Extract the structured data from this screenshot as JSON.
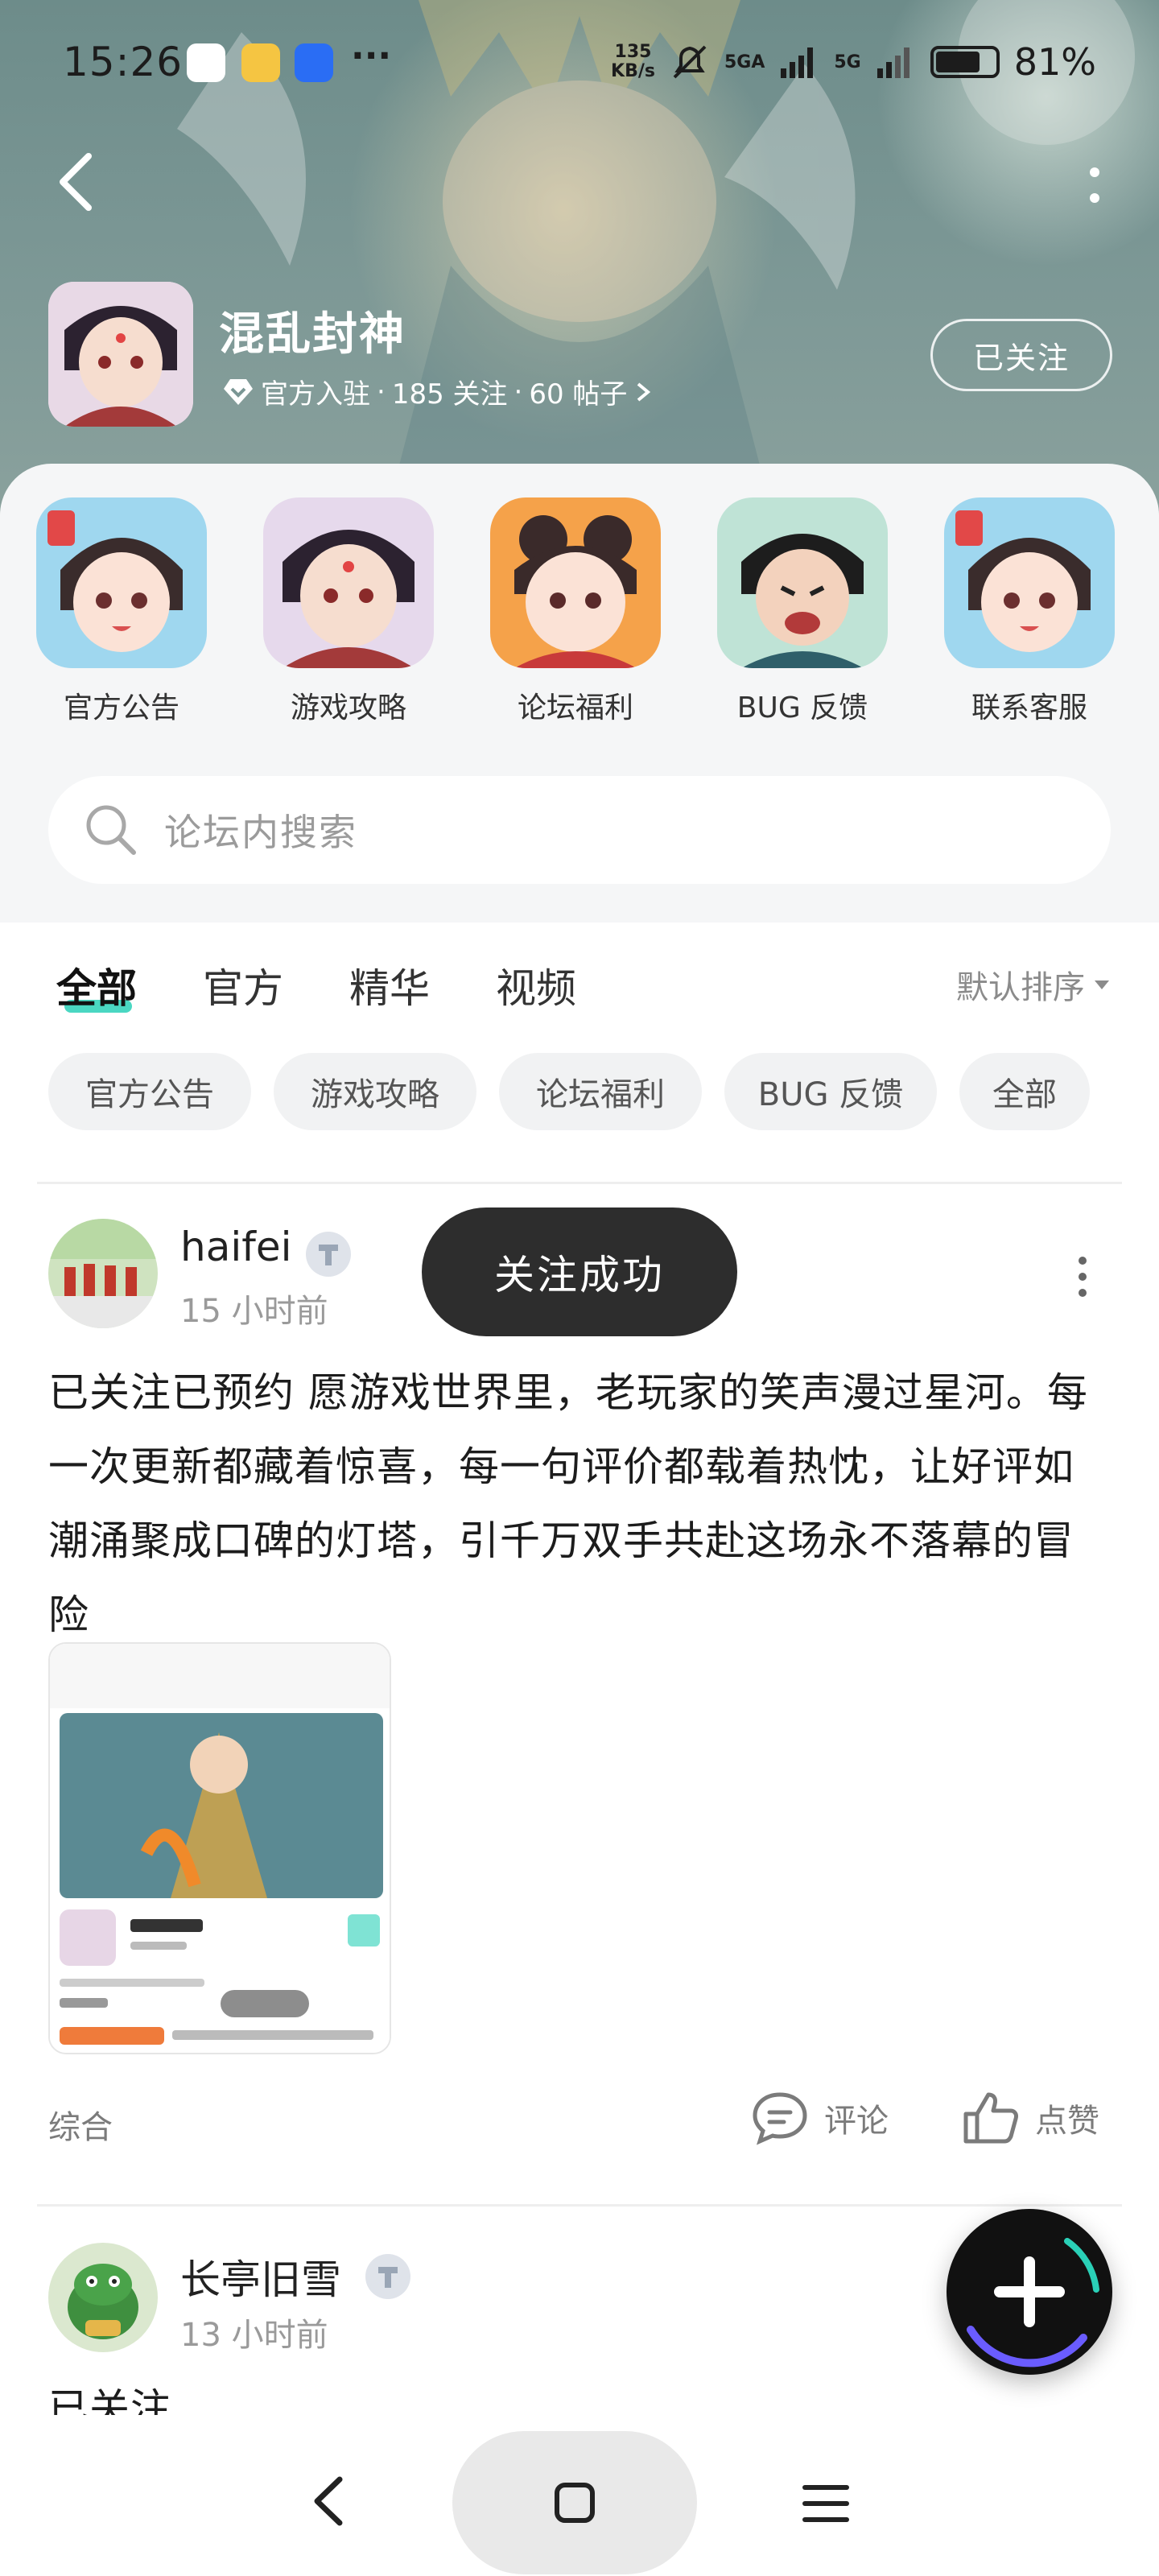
{
  "status_bar": {
    "time": "15:26",
    "speed": "135\nKB/s",
    "network_1": "5GA",
    "network_2": "5G",
    "battery": "81%",
    "battery_level": 0.81,
    "more": "···",
    "apps": [
      "du-app-icon",
      "weibo-icon",
      "baidu-icon"
    ]
  },
  "header": {
    "forum_name": "混乱封神",
    "official": "官方入驻",
    "followers": "185 关注",
    "posts": "60 帖子",
    "meta_sep": "·",
    "follow_label": "已关注"
  },
  "categories": [
    {
      "label": "官方公告"
    },
    {
      "label": "游戏攻略"
    },
    {
      "label": "论坛福利"
    },
    {
      "label": "BUG 反馈"
    },
    {
      "label": "联系客服"
    }
  ],
  "search": {
    "placeholder": "论坛内搜索"
  },
  "tabs": [
    {
      "label": "全部",
      "active": true
    },
    {
      "label": "官方"
    },
    {
      "label": "精华"
    },
    {
      "label": "视频"
    }
  ],
  "sort_label": "默认排序",
  "chips": [
    "官方公告",
    "游戏攻略",
    "论坛福利",
    "BUG 反馈",
    "全部"
  ],
  "posts": [
    {
      "user": "haifei",
      "time": "15 小时前",
      "text": "已关注已预约 愿游戏世界里，老玩家的笑声漫过星河。每一次更新都藏着惊喜，每一句评价都载着热忱，让好评如潮涌聚成口碑的灯塔，引千万双手共赴这场永不落幕的冒险",
      "tag": "综合",
      "comment_label": "评论",
      "like_label": "点赞"
    },
    {
      "user": "长亭旧雪",
      "time": "13 小时前",
      "text": "已关注"
    }
  ],
  "toast": "关注成功",
  "colors": {
    "accent": "#2ad0b7",
    "banner": "#7a9694",
    "toast": "#2d2d2d",
    "fab": "#111111"
  }
}
